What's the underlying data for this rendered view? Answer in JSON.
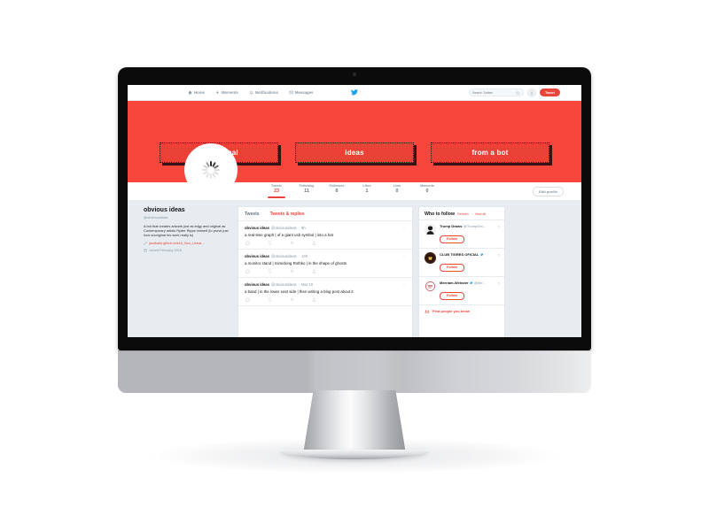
{
  "mockup": {
    "device": "imac-desktop-monitor"
  },
  "navbar": {
    "items": [
      {
        "label": "Home",
        "icon": "home-icon"
      },
      {
        "label": "Moments",
        "icon": "lightning-icon"
      },
      {
        "label": "Notifications",
        "icon": "bell-icon"
      },
      {
        "label": "Messages",
        "icon": "envelope-icon"
      }
    ],
    "logo": "twitter-bird-icon",
    "search": {
      "placeholder": "Search Twitter",
      "value": "",
      "icon": "search-icon"
    },
    "account_avatar": "user-avatar-icon",
    "tweet_button": "Tweet"
  },
  "banner": {
    "background_color": "#f8463c",
    "boxes": [
      {
        "label": "un-original"
      },
      {
        "label": "ideas"
      },
      {
        "label": "from a bot"
      }
    ]
  },
  "profile_bar": {
    "avatar": "loading-spinner-avatar",
    "stats": [
      {
        "key": "Tweets",
        "value": "23",
        "active": true
      },
      {
        "key": "Following",
        "value": "11",
        "active": false
      },
      {
        "key": "Followers",
        "value": "6",
        "active": false
      },
      {
        "key": "Likes",
        "value": "1",
        "active": false
      },
      {
        "key": "Lists",
        "value": "0",
        "active": false
      },
      {
        "key": "Moments",
        "value": "0",
        "active": false
      }
    ],
    "edit_profile": "Edit profile"
  },
  "profile": {
    "name": "obvious ideas",
    "handle": "@obviousideas",
    "bio": "A bot that creates artwork just as edgy and original as Contemporary artists Ryder Ripps himself (to prove just how unoriginal his work really is)",
    "link": "jandkatie.github.io/s16_Non_Linear...",
    "link_icon": "link-icon",
    "joined": "Joined February 2018",
    "joined_icon": "calendar-icon"
  },
  "timeline": {
    "tabs": [
      {
        "label": "Tweets",
        "active": false
      },
      {
        "label": "Tweets & replies",
        "active": true
      }
    ],
    "tweets": [
      {
        "name": "obvious ideas",
        "handle": "@obviousideas",
        "separator": "·",
        "time": "9h",
        "text": "a real-time graph  |  of a giant usb symbol  |  into a hat"
      },
      {
        "name": "obvious ideas",
        "handle": "@obviousideas",
        "separator": "·",
        "time": "16h",
        "text": "a monitor stand  |  mimicking Rothko  |  in the shape of ghosts"
      },
      {
        "name": "obvious ideas",
        "handle": "@obviousideas",
        "separator": "·",
        "time": "Mar 10",
        "text": "a band  |  in the lower east side  |  then writing a blog post about it"
      }
    ],
    "actions": [
      "reply-icon",
      "retweet-icon",
      "like-icon",
      "share-icon"
    ],
    "caret": "chevron-down-icon"
  },
  "who_to_follow": {
    "title": "Who to follow",
    "refresh": "Refresh",
    "separator": "·",
    "view_all": "View all",
    "dismiss": "×",
    "suggestions": [
      {
        "name": "Trump Draws",
        "handle": "@TrumpDra...",
        "verified": false,
        "follow": "Follow"
      },
      {
        "name": "CLUB TIGRES OFICIAL",
        "handle": "",
        "verified": true,
        "follow": "Follow"
      },
      {
        "name": "Merriam-Webster",
        "handle": "@Me...",
        "verified": true,
        "follow": "Follow"
      }
    ],
    "find_people": "Find people you know",
    "find_icon": "contacts-icon"
  },
  "colors": {
    "brand_red": "#e8453c",
    "banner_red": "#f8463c",
    "box_red": "#ea4136",
    "twitter_blue": "#1da1f2",
    "text_dark": "#14171a",
    "text_muted": "#8899a6",
    "page_bg": "#e6ecf0"
  }
}
